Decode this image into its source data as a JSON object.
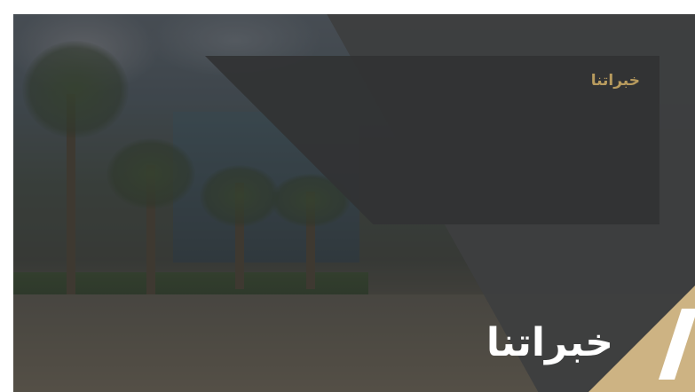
{
  "slide": {
    "card_title": "خبراتنا",
    "main_heading": "خبراتنا"
  },
  "colors": {
    "accent_gold": "#cdb383",
    "title_gold": "#b89b5e",
    "panel_dark": "#323334"
  },
  "icons": [
    "slash-mark-icon"
  ]
}
